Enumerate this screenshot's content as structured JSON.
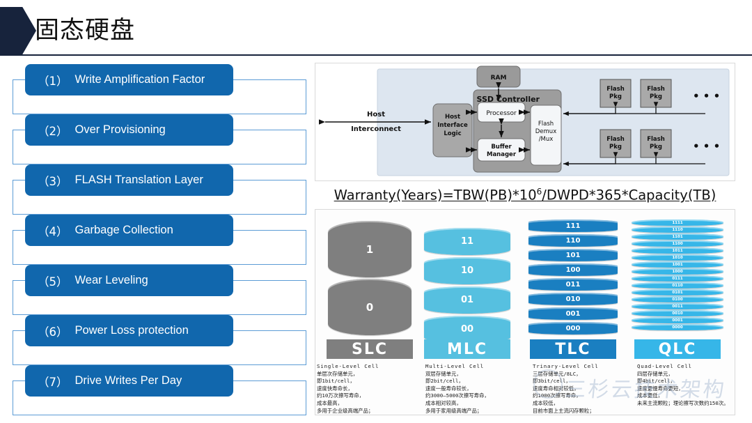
{
  "header": {
    "title": "固态硬盘",
    "arrow_color": "#17233c",
    "rule_color": "#17233c"
  },
  "colors": {
    "chip_blue": "#1167ad",
    "outline_blue": "#5b9bd5",
    "slc_gray": "#7f7f7f",
    "mlc_blue": "#56c0e0",
    "tlc_blue": "#1a7fc1",
    "qlc_blue": "#36b6e8"
  },
  "topics": [
    {
      "num": "（1）",
      "label": "Write Amplification Factor"
    },
    {
      "num": "（2）",
      "label": "Over Provisioning"
    },
    {
      "num": "（3）",
      "label": "FLASH Translation Layer"
    },
    {
      "num": "（4）",
      "label": "Garbage Collection"
    },
    {
      "num": "（5）",
      "label": "Wear Leveling"
    },
    {
      "num": "（6）",
      "label": "Power Loss protection"
    },
    {
      "num": "（7）",
      "label": "Drive Writes Per Day"
    }
  ],
  "ssd_diagram": {
    "alt": "ssd-controller-block-diagram",
    "host_label_line1": "Host",
    "host_label_line2": "Interconnect",
    "host_interface": "Host\nInterface\nLogic",
    "controller_title": "SSD Controller",
    "ram": "RAM",
    "processor": "Processor",
    "buffer_manager": "Buffer\nManager",
    "flash_demux": "Flash\nDemux\n/Mux",
    "flash_pkg": "Flash\nPkg",
    "ellipsis": "• • •"
  },
  "formula": {
    "prefix": "Warranty(Years)=TBW(PB)*10",
    "exponent": "6",
    "suffix": "/DWPD*365*Capacity(TB)"
  },
  "nand": {
    "columns": [
      {
        "badge": "SLC",
        "color": "#7f7f7f",
        "levels": [
          "1",
          "0"
        ],
        "title": "Single-Level Cell",
        "desc": "单层次存储单元，\n即1bit/cell，\n速度快寿命长，\n约10万次擦写寿命，\n成本最高，\n多用于企业级高端产品；"
      },
      {
        "badge": "MLC",
        "color": "#56c0e0",
        "levels": [
          "11",
          "10",
          "01",
          "00"
        ],
        "title": "Multi-Level Cell",
        "desc": "双层存储单元，\n即2bit/cell，\n速度一般寿命较长，\n约3000—5000次擦写寿命，\n成本相对较高，\n多用于家用级高端产品；"
      },
      {
        "badge": "TLC",
        "color": "#1a7fc1",
        "levels": [
          "111",
          "110",
          "101",
          "100",
          "011",
          "010",
          "001",
          "000"
        ],
        "title": "Trinary-Level Cell",
        "desc": "三层存储单元/8LC，\n即3bit/cell，\n速度寿命相对较低，\n约1000次擦写寿命，\n成本较低，\n目前市面上主流闪存颗粒；"
      },
      {
        "badge": "QLC",
        "color": "#36b6e8",
        "levels": [
          "1111",
          "1110",
          "1101",
          "1100",
          "1011",
          "1010",
          "1001",
          "1000",
          "0111",
          "0110",
          "0101",
          "0100",
          "0011",
          "0010",
          "0001",
          "0000"
        ],
        "title": "Quad-Level Cell",
        "desc": "四层存储单元，\n即4bit/cell，\n速度更慢寿命更短，\n成本更低，\n未来主流颗粒；理论擦写次数约150次。"
      }
    ]
  },
  "watermark": {
    "text": "三杉云技术架构"
  }
}
